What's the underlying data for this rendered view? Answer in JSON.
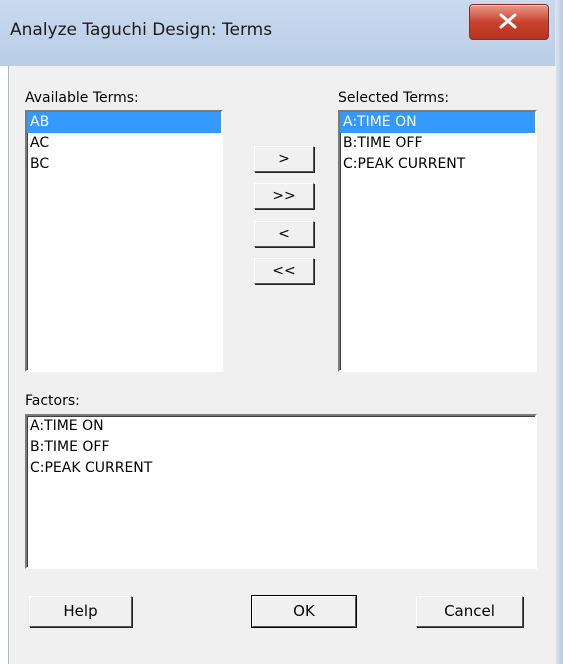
{
  "window": {
    "title": "Analyze Taguchi Design: Terms"
  },
  "available": {
    "label": "Available Terms:",
    "items": [
      "AB",
      "AC",
      "BC"
    ],
    "selected_index": 0
  },
  "selected": {
    "label": "Selected Terms:",
    "items": [
      "A:TIME ON",
      "B:TIME OFF",
      "C:PEAK CURRENT"
    ],
    "selected_index": 0
  },
  "move_buttons": {
    "add": ">",
    "add_all": ">>",
    "remove": "<",
    "remove_all": "<<"
  },
  "factors": {
    "label": "Factors:",
    "items": [
      "A:TIME ON",
      "B:TIME OFF",
      "C:PEAK CURRENT"
    ]
  },
  "buttons": {
    "help": "Help",
    "ok": "OK",
    "cancel": "Cancel"
  },
  "colors": {
    "selection": "#3399ff",
    "dialog_bg": "#f0f0f0",
    "title_bar": "#c9daef",
    "close_button": "#c9442e"
  },
  "icons": {
    "close": "close-x-icon"
  }
}
